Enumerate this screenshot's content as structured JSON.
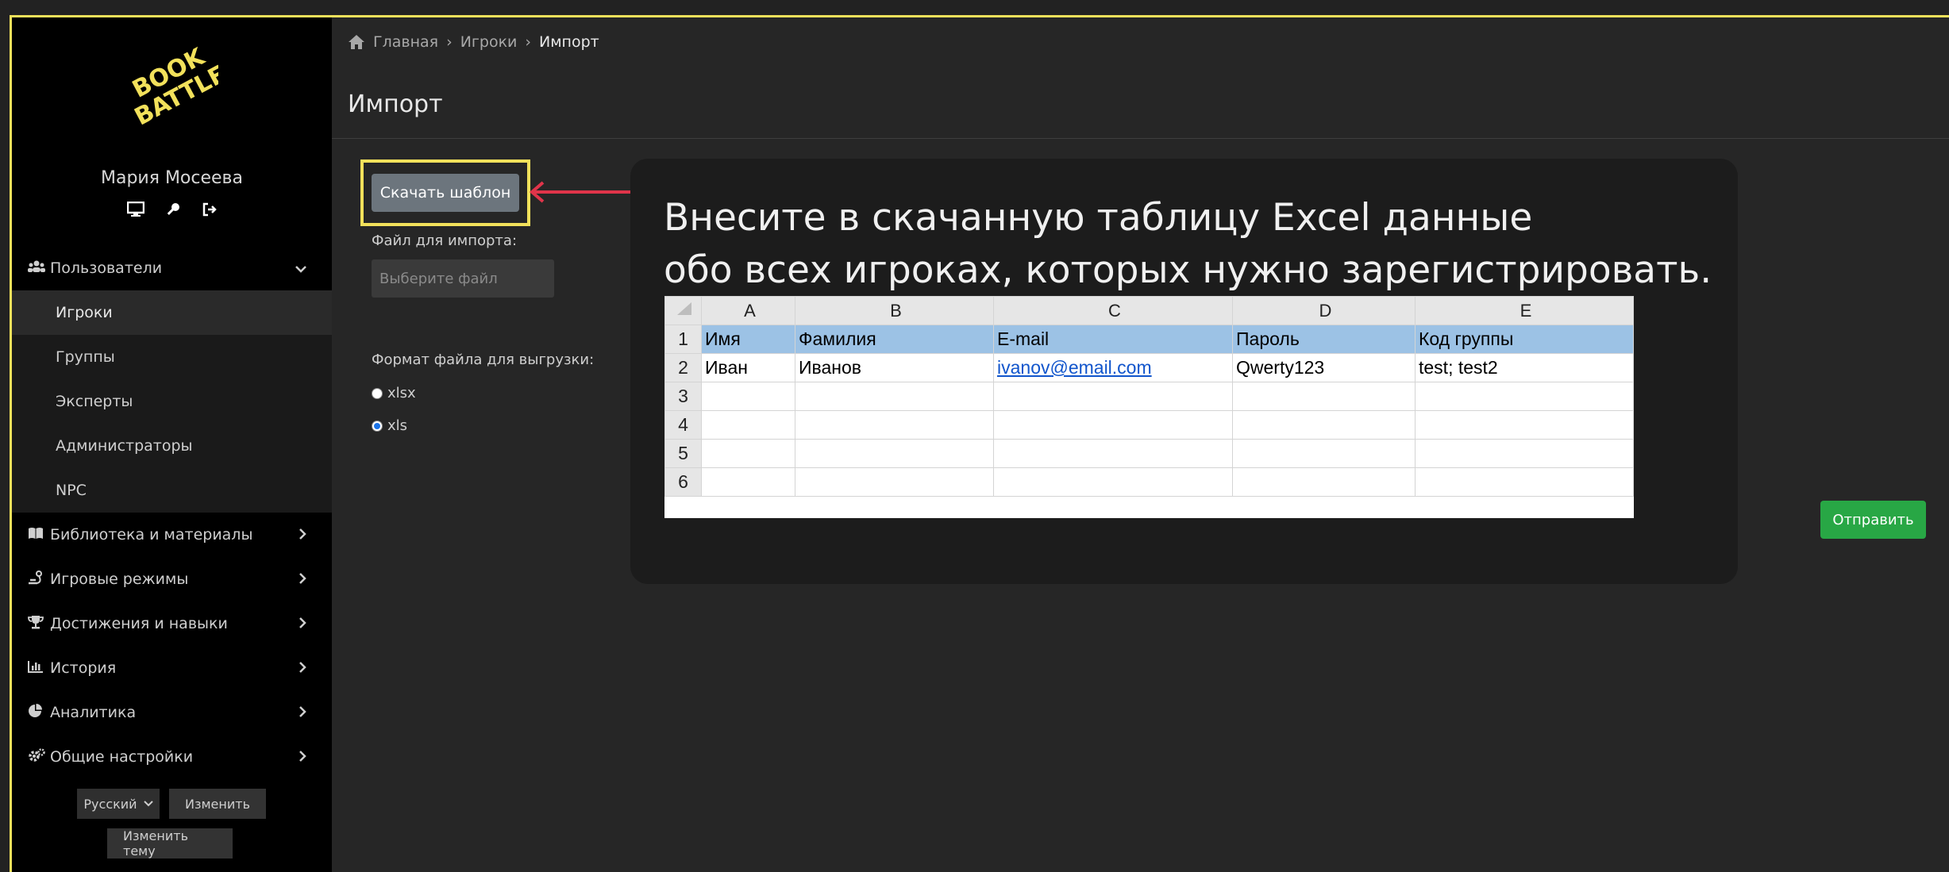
{
  "colors": {
    "highlight": "#f2e15b",
    "accent_arrow": "#e0344a",
    "submit": "#28a745",
    "download": "#6c757d"
  },
  "sidebar": {
    "user_name": "Мария Мосеева",
    "user_icons": [
      "monitor-icon",
      "key-icon",
      "logout-icon"
    ],
    "menu": [
      {
        "label": "Пользователи",
        "icon": "users-icon",
        "expanded": true,
        "children": [
          "Игроки",
          "Группы",
          "Эксперты",
          "Администраторы",
          "NPC"
        ]
      },
      {
        "label": "Библиотека и материалы",
        "icon": "book-icon"
      },
      {
        "label": "Игровые режимы",
        "icon": "modes-icon"
      },
      {
        "label": "Достижения и навыки",
        "icon": "trophy-icon"
      },
      {
        "label": "История",
        "icon": "chart-icon"
      },
      {
        "label": "Аналитика",
        "icon": "pie-icon"
      },
      {
        "label": "Общие настройки",
        "icon": "cogs-icon"
      }
    ],
    "language": "Русский",
    "change_label": "Изменить",
    "change_theme_label": "Изменить тему"
  },
  "breadcrumb": {
    "home": "Главная",
    "players": "Игроки",
    "current": "Импорт"
  },
  "page_title": "Импорт",
  "form": {
    "download_label": "Скачать шаблон",
    "file_label": "Файл для импорта:",
    "file_placeholder": "Выберите файл",
    "format_label": "Формат файла для выгрузки:",
    "formats": [
      "xlsx",
      "xls"
    ],
    "selected_format": "xls",
    "submit_label": "Отправить"
  },
  "callout": {
    "line1": "Внесите в скачанную таблицу Excel данные",
    "line2": "обо всех игроках, которых нужно зарегистрировать.",
    "excel": {
      "columns": [
        "A",
        "B",
        "C",
        "D",
        "E"
      ],
      "rows": [
        [
          "1",
          "Имя",
          "Фамилия",
          "E-mail",
          "Пароль",
          "Код группы"
        ],
        [
          "2",
          "Иван",
          "Иванов",
          "ivanov@email.com",
          "Qwerty123",
          "test; test2"
        ],
        [
          "3",
          "",
          "",
          "",
          "",
          ""
        ],
        [
          "4",
          "",
          "",
          "",
          "",
          ""
        ],
        [
          "5",
          "",
          "",
          "",
          "",
          ""
        ],
        [
          "6",
          "",
          "",
          "",
          "",
          ""
        ]
      ]
    }
  }
}
